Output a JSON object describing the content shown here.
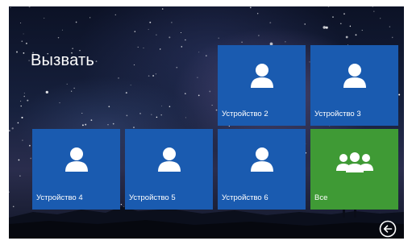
{
  "screen": {
    "title": "Вызвать"
  },
  "tiles": [
    {
      "label": "Устройство 2",
      "icon": "person-icon",
      "color": "#1a5bb0"
    },
    {
      "label": "Устройство 3",
      "icon": "person-icon",
      "color": "#1a5bb0"
    },
    {
      "label": "Устройство 4",
      "icon": "person-icon",
      "color": "#1a5bb0"
    },
    {
      "label": "Устройство 5",
      "icon": "person-icon",
      "color": "#1a5bb0"
    },
    {
      "label": "Устройство 6",
      "icon": "person-icon",
      "color": "#1a5bb0"
    },
    {
      "label": "Все",
      "icon": "group-icon",
      "color": "#3f9a35"
    }
  ],
  "nav": {
    "back_icon": "back-arrow-icon"
  }
}
